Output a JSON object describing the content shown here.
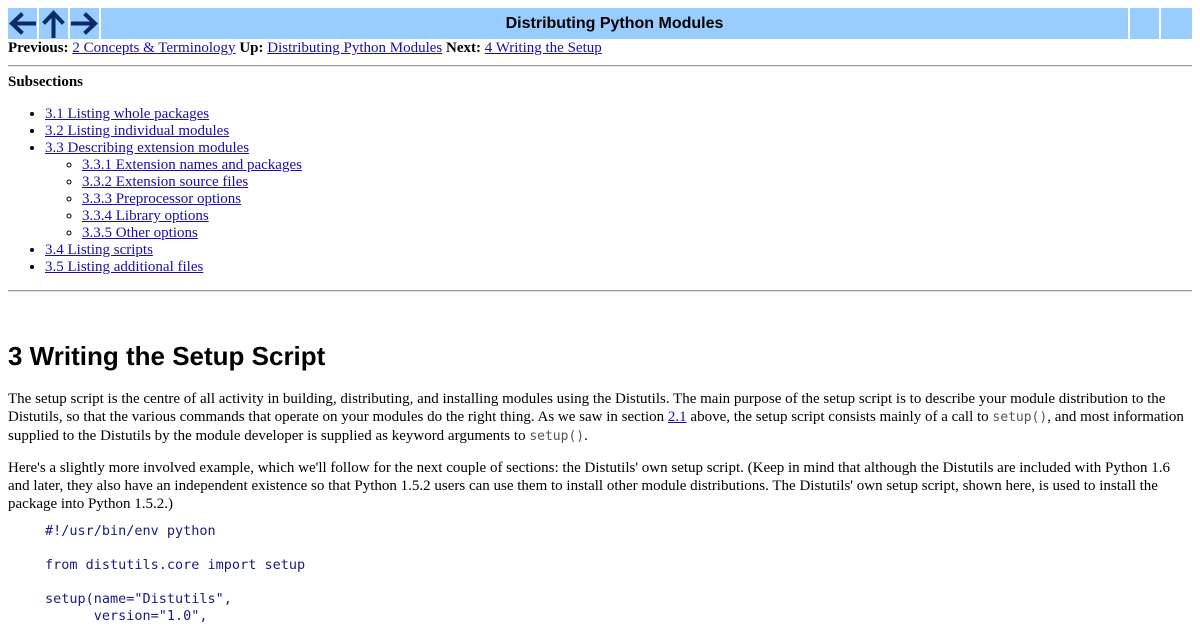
{
  "nav": {
    "prev_icon": "left-arrow-icon",
    "up_icon": "up-arrow-icon",
    "next_icon": "right-arrow-icon",
    "title": "Distributing Python Modules",
    "bar_color": "#99ccff"
  },
  "navlinks": {
    "previous_label": "Previous:",
    "previous_link": "2 Concepts & Terminology",
    "up_label": "Up:",
    "up_link": "Distributing Python Modules",
    "next_label": "Next:",
    "next_link": "4 Writing the Setup"
  },
  "subsections": {
    "title": "Subsections",
    "items": [
      "3.1 Listing whole packages",
      "3.2 Listing individual modules",
      "3.3 Describing extension modules",
      "3.4 Listing scripts",
      "3.5 Listing additional files"
    ],
    "subitems": [
      "3.3.1 Extension names and packages",
      "3.3.2 Extension source files",
      "3.3.3 Preprocessor options",
      "3.3.4 Library options",
      "3.3.5 Other options"
    ]
  },
  "heading": "3 Writing the Setup Script",
  "para1": {
    "text_a": "The setup script is the centre of all activity in building, distributing, and installing modules using the Distutils. The main purpose of the setup script is to describe your module distribution to the Distutils, so that the various commands that operate on your modules do the right thing. As we saw in section ",
    "link": "2.1",
    "text_b": " above, the setup script consists mainly of a call to ",
    "code_a": "setup()",
    "text_c": ", and most information supplied to the Distutils by the module developer is supplied as keyword arguments to ",
    "code_b": "setup()",
    "text_d": "."
  },
  "para2": "Here's a slightly more involved example, which we'll follow for the next couple of sections: the Distutils' own setup script. (Keep in mind that although the Distutils are included with Python 1.6 and later, they also have an independent existence so that Python 1.5.2 users can use them to install other module distributions. The Distutils' own setup script, shown here, is used to install the package into Python 1.5.2.)",
  "code": {
    "line1": "#!/usr/bin/env python",
    "line2": "from distutils.core import setup",
    "line3": "setup(name=\"Distutils\",",
    "line4": "      version=\"1.0\","
  }
}
